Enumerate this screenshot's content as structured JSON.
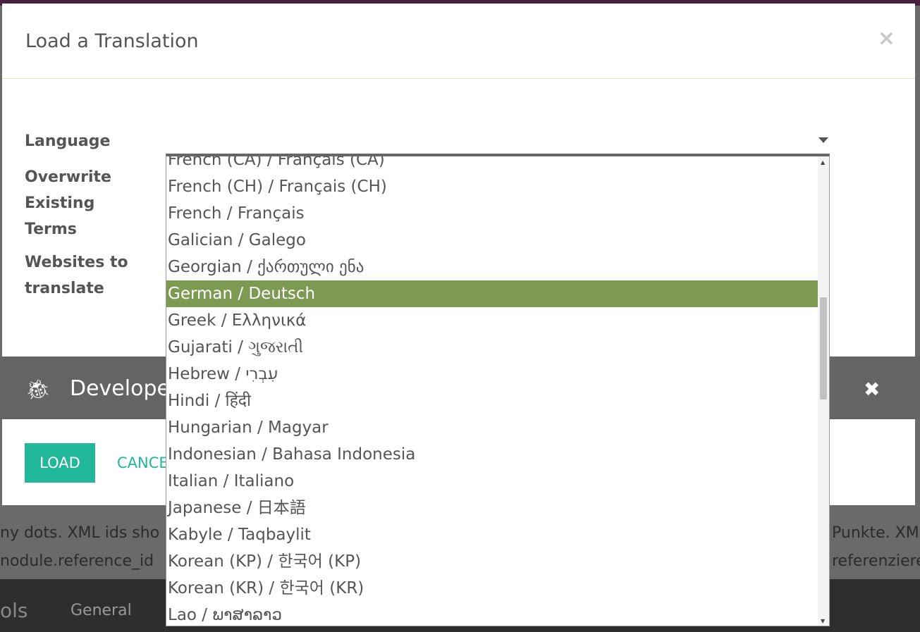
{
  "modal": {
    "title": "Load a Translation",
    "close": "×",
    "labels": {
      "language": "Language",
      "overwrite": "Overwrite Existing Terms",
      "websites": "Websites to translate"
    },
    "load_button": "LOAD",
    "cancel_button": "CANCEL"
  },
  "dev_bar": {
    "title": "Developer mode",
    "close": "✖",
    "icon": "bug-icon"
  },
  "background": {
    "line1_left": "ny dots. XML ids sho",
    "line2_left": "nodule.reference_id",
    "line1_right": "Punkte. XM",
    "line2_right": "referenziere",
    "tab_app": "ols",
    "tab_general": "General"
  },
  "dropdown": {
    "selected": "German / Deutsch",
    "highlight_color": "#7c9a52",
    "options": [
      "French (CA) / Français (CA)",
      "French (CH) / Français (CH)",
      "French / Français",
      "Galician / Galego",
      "Georgian / ქართული ენა",
      "German / Deutsch",
      "Greek / Ελληνικά",
      "Gujarati / ગુજરાતી",
      "Hebrew / עִבְרִי",
      "Hindi / हिंदी",
      "Hungarian / Magyar",
      "Indonesian / Bahasa Indonesia",
      "Italian / Italiano",
      "Japanese / 日本語",
      "Kabyle / Taqbaylit",
      "Korean (KP) / 한국어 (KP)",
      "Korean (KR) / 한국어 (KR)",
      "Lao / ພາສາລາວ"
    ]
  }
}
